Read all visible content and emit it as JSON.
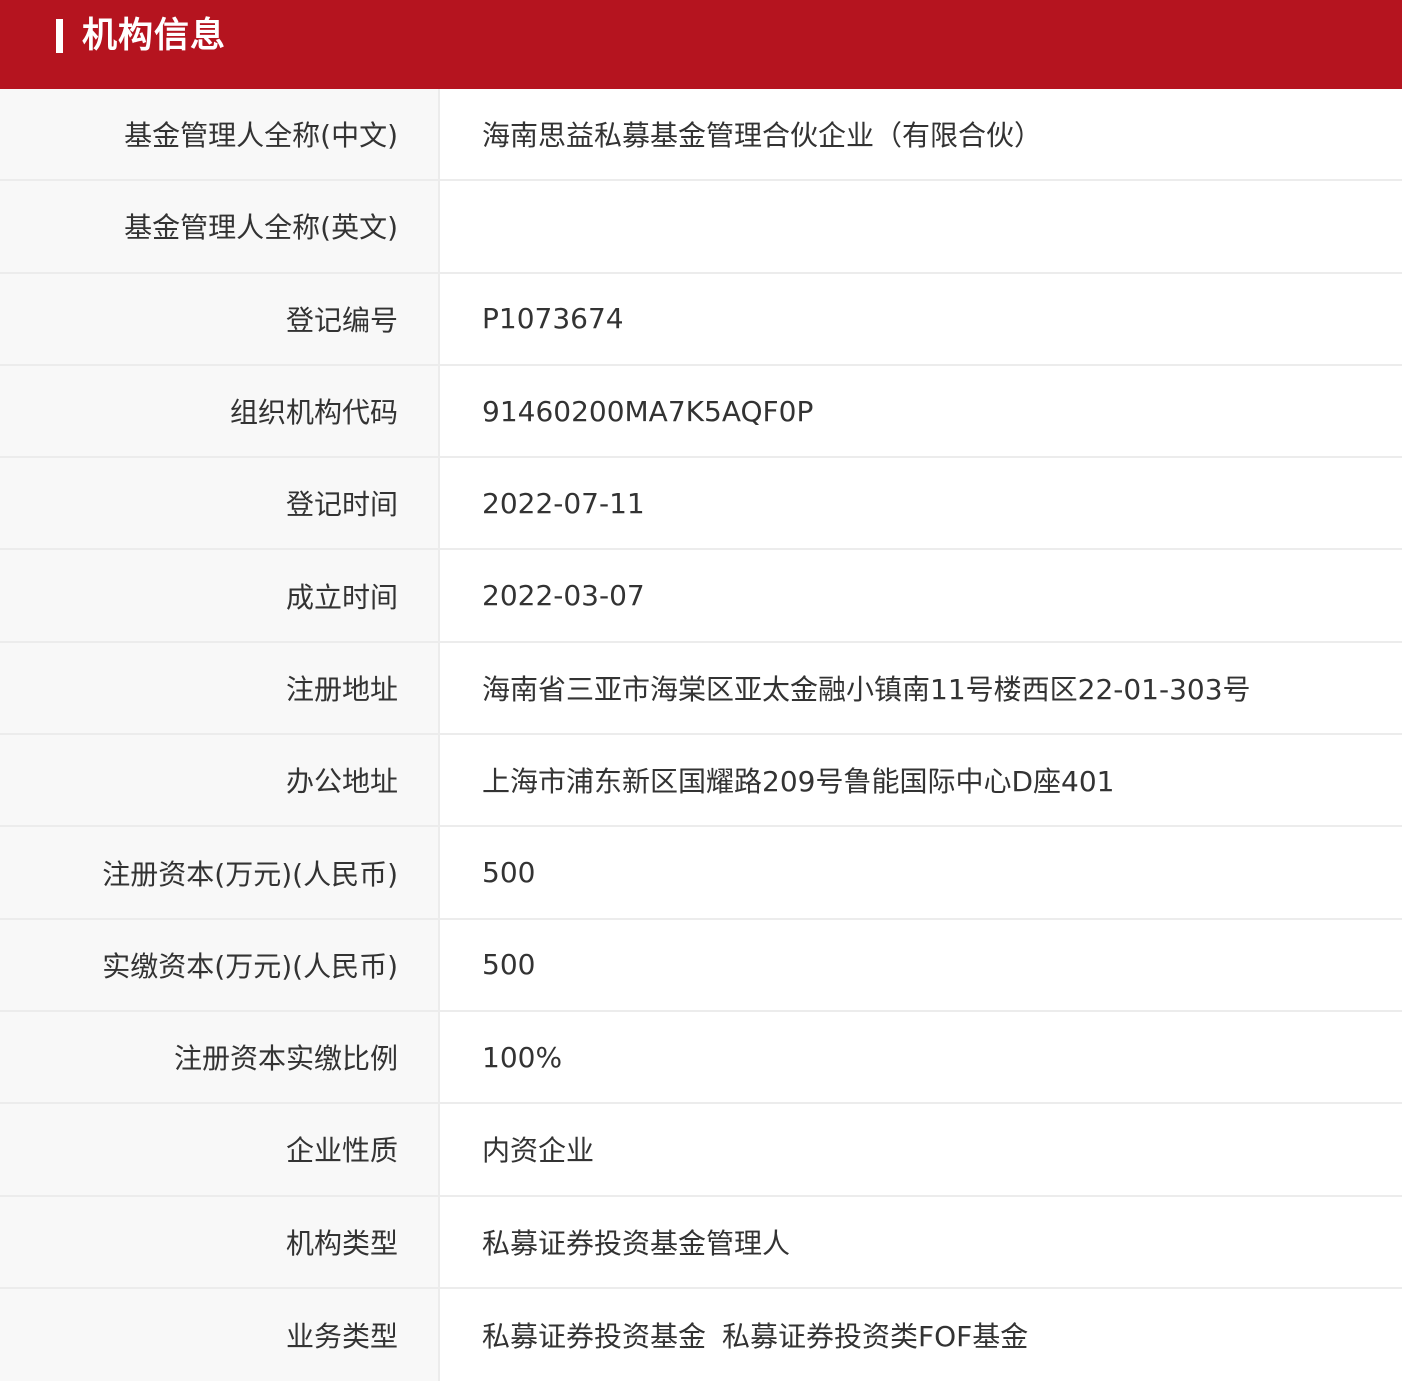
{
  "header": {
    "title": "机构信息"
  },
  "rows": [
    {
      "label": "基金管理人全称(中文)",
      "value": "海南思益私募基金管理合伙企业（有限合伙）"
    },
    {
      "label": "基金管理人全称(英文)",
      "value": ""
    },
    {
      "label": "登记编号",
      "value": "P1073674"
    },
    {
      "label": "组织机构代码",
      "value": "91460200MA7K5AQF0P"
    },
    {
      "label": "登记时间",
      "value": "2022-07-11"
    },
    {
      "label": "成立时间",
      "value": "2022-03-07"
    },
    {
      "label": "注册地址",
      "value": "海南省三亚市海棠区亚太金融小镇南11号楼西区22-01-303号"
    },
    {
      "label": "办公地址",
      "value": "上海市浦东新区国耀路209号鲁能国际中心D座401"
    },
    {
      "label": "注册资本(万元)(人民币)",
      "value": "500"
    },
    {
      "label": "实缴资本(万元)(人民币)",
      "value": "500"
    },
    {
      "label": "注册资本实缴比例",
      "value": "100%"
    },
    {
      "label": "企业性质",
      "value": "内资企业"
    },
    {
      "label": "机构类型",
      "value": "私募证券投资基金管理人"
    },
    {
      "label": "业务类型",
      "values": [
        "私募证券投资基金",
        "私募证券投资类FOF基金"
      ]
    }
  ],
  "colors": {
    "header_bg": "#b5141f",
    "label_bg": "#f8f8f8",
    "border": "#ececec",
    "text": "#333333"
  }
}
